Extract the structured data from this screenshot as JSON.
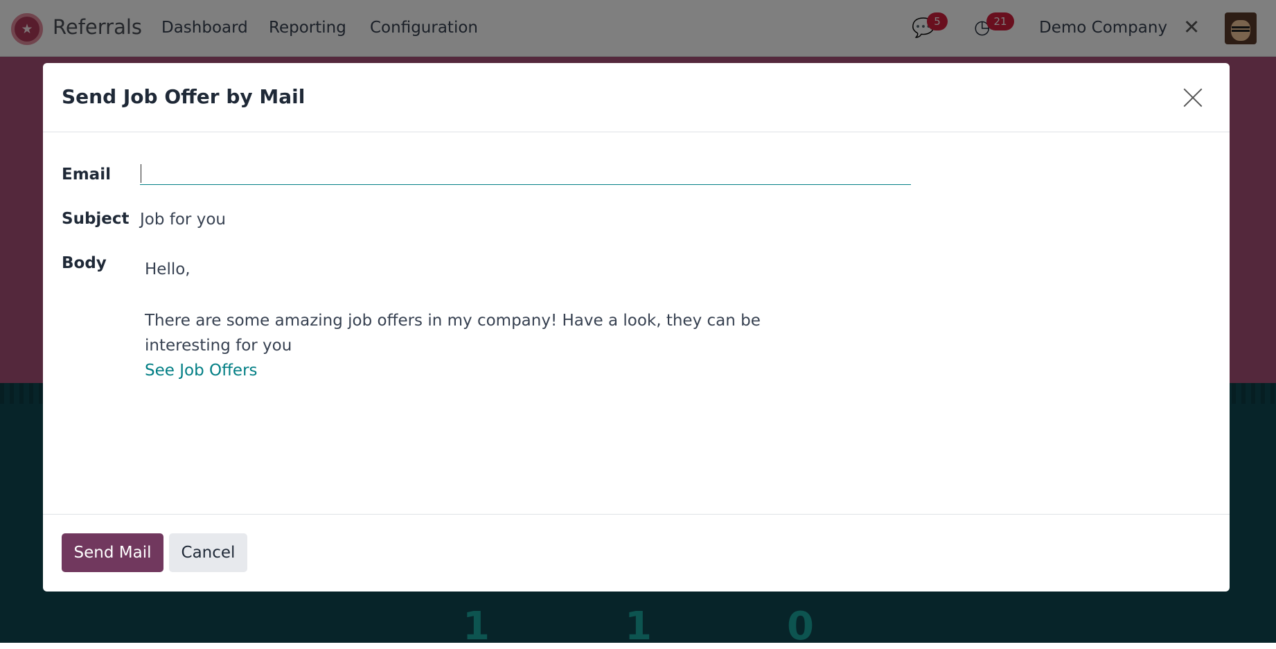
{
  "topbar": {
    "app_name": "Referrals",
    "nav": [
      "Dashboard",
      "Reporting",
      "Configuration"
    ],
    "messages_badge": "5",
    "activities_badge": "21",
    "company": "Demo Company",
    "icons": {
      "app": "referrals-app-icon",
      "messages": "chat-icon",
      "activities": "clock-icon",
      "debug": "tools-icon",
      "user": "avatar"
    }
  },
  "background": {
    "stats": [
      "1",
      "1",
      "0"
    ]
  },
  "modal": {
    "title": "Send Job Offer by Mail",
    "fields": {
      "email_label": "Email",
      "email_value": "",
      "subject_label": "Subject",
      "subject_value": "Job for you",
      "body_label": "Body"
    },
    "body": {
      "greeting": "Hello,",
      "text": "There are some amazing job offers in my company! Have a look, they can be interesting for you",
      "link": "See Job Offers"
    },
    "buttons": {
      "send": "Send Mail",
      "cancel": "Cancel"
    }
  },
  "colors": {
    "brand": "#71385e",
    "link": "#017e84",
    "badge": "#d21f3c"
  }
}
